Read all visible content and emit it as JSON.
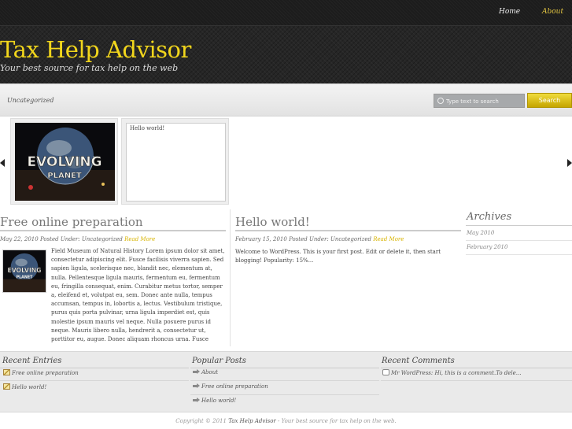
{
  "nav": {
    "home": "Home",
    "about": "About"
  },
  "site": {
    "title": "Tax Help Advisor",
    "description": "Your best source for tax help on the web"
  },
  "subbar": {
    "category": "Uncategorized",
    "search_placeholder": "Type text to search",
    "search_button": "Search"
  },
  "slider": {
    "slide1_image_text": [
      "EVOLVING",
      "PLANET"
    ],
    "slide2_text": "Hello world!"
  },
  "posts": [
    {
      "title": "Free online preparation",
      "date": "May 22, 2010",
      "posted_under_label": "Posted Under:",
      "category": "Uncategorized",
      "read_more": "Read More",
      "thumb_text": [
        "EVOLVING",
        "PLANET"
      ],
      "body": "Field Museum of Natural History Lorem ipsum dolor sit amet, consectetur adipiscing elit. Fusce facilisis viverra sapien. Sed sapien ligula, scelerisque nec, blandit nec, elementum at, nulla. Pellentesque ligula mauris, fermentum eu, fermentum eu, fringilla consequat, enim. Curabitur metus tortor, semper a, eleifend et, volutpat eu, sem. Donec ante nulla, tempus accumsan, tempus in, lobortis a, lectus. Vestibulum tristique, purus quis porta pulvinar, urna ligula imperdiet est, quis molestie ipsum mauris vel neque. Nulla posuere purus id neque. Mauris libero nulla, hendrerit a, consectetur ut, porttitor eu, augue. Donec aliquam rhoncus urna. Fusce facilisis porta odio. In ac lorem ipsum dolor sit amet"
    },
    {
      "title": "Hello world!",
      "date": "February 15, 2010",
      "posted_under_label": "Posted Under:",
      "category": "Uncategorized",
      "read_more": "Read More",
      "body": "Welcome to WordPress. This is your first post. Edit or delete it, then start blogging! Popularity: 15%..."
    }
  ],
  "archives": {
    "title": "Archives",
    "items": [
      "May 2010",
      "February 2010"
    ]
  },
  "widgets": {
    "recent_entries": {
      "title": "Recent Entries",
      "items": [
        "Free online preparation",
        "Hello world!"
      ]
    },
    "popular_posts": {
      "title": "Popular Posts",
      "items": [
        "About",
        "Free online preparation",
        "Hello world!"
      ]
    },
    "recent_comments": {
      "title": "Recent Comments",
      "items": [
        "Mr WordPress: Hi, this is a comment.To dele..."
      ]
    }
  },
  "footer": {
    "copyright_prefix": "Copyright © 2011",
    "site_name": "Tax Help Advisor",
    "copyright_suffix": "- Your best source for tax help on the web."
  },
  "colors": {
    "accent": "#f2d61c",
    "read_more": "#d8b400",
    "header_bg": "#262626"
  }
}
